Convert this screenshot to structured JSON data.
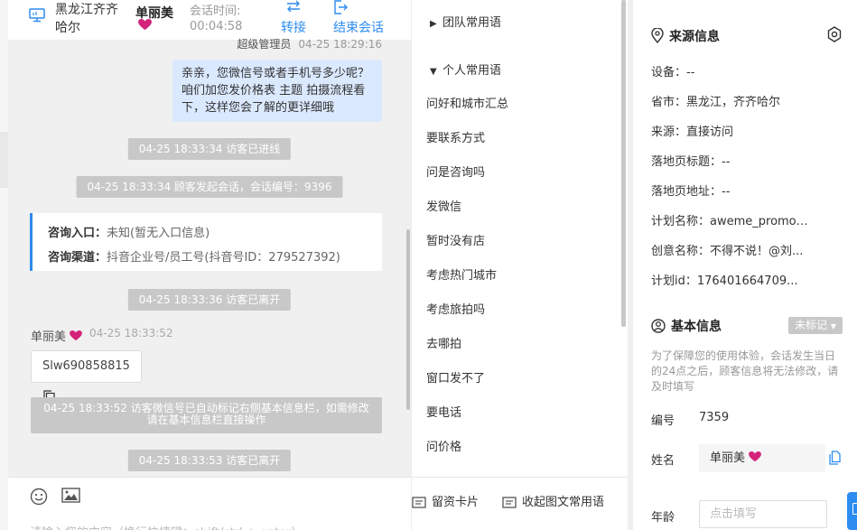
{
  "header": {
    "location": "黑龙江齐齐哈尔",
    "visitor_name": "单丽美",
    "session_time_label": "会话时间:",
    "session_time": "00:04:58",
    "transfer_label": "转接",
    "end_label": "结束会话"
  },
  "messages": {
    "sender_name": "超级管理员",
    "sender_time": "04-25 18:29:16",
    "agent_bubble": "亲亲，您微信号或者手机号多少呢？咱们加您发价格表 主题 拍摄流程看下，这样您会了解的更详细哦",
    "sys_1": "04-25 18:33:34 访客已进线",
    "sys_2": "04-25 18:33:34 顾客发起会话，会话编号：9396",
    "entry_label": "咨询入口：",
    "entry_value": "未知(暂无入口信息)",
    "channel_label": "咨询渠道：",
    "channel_value": "抖音企业号/员工号(抖音号ID：279527392)",
    "sys_3": "04-25 18:33:36 访客已离开",
    "visitor_name": "单丽美",
    "visitor_time": "04-25 18:33:52",
    "visitor_wechat": "Slw690858815",
    "sys_4": "04-25 18:33:52 访客微信号已自动标记右侧基本信息栏，如需修改请在基本信息栏直接操作",
    "sys_5": "04-25 18:33:53 访客已离开"
  },
  "input": {
    "placeholder": "请输入您的内容（换行快捷键：shift/ctrl + enter）"
  },
  "phrases": {
    "team_group": "团队常用语",
    "personal_group": "个人常用语",
    "items": [
      "问好和城市汇总",
      "要联系方式",
      "问是咨询吗",
      "发微信",
      "暂时没有店",
      "考虑热门城市",
      "考虑旅拍吗",
      "去哪拍",
      "窗口发不了",
      "要电话",
      "问价格"
    ],
    "footer_card": "留资卡片",
    "footer_collapse": "收起图文常用语"
  },
  "source_info": {
    "title": "来源信息",
    "device": "设备：--",
    "province_city": "省市：黑龙江，齐齐哈尔",
    "source": "来源：直接访问",
    "landing_title": "落地页标题：--",
    "landing_url": "落地页地址：--",
    "plan_name": "计划名称：aweme_promot...",
    "creative_name": "创意名称：不得不说！@刘...",
    "plan_id": "计划id：176401664709..."
  },
  "basic_info": {
    "title": "基本信息",
    "tag_label": "未标记",
    "notice": "为了保障您的使用体验，会话发生当日的24点之后，顾客信息将无法修改，请及时填写",
    "id_label": "编号",
    "id_value": "7359",
    "name_label": "姓名",
    "name_value": "单丽美",
    "age_label": "年龄",
    "age_placeholder": "点击填写"
  },
  "colors": {
    "accent": "#2d8cf0",
    "agent_bubble": "#dbe9ff",
    "system_notice": "#c8c8c8",
    "heart": "#d4237a"
  },
  "icons": [
    "monitor-icon",
    "heart-icon",
    "transfer-icon",
    "exit-icon",
    "caret-right-icon",
    "caret-down-icon",
    "copy-icon",
    "emoji-icon",
    "image-icon",
    "card-icon",
    "location-pin-icon",
    "settings-icon",
    "user-circle-icon"
  ]
}
